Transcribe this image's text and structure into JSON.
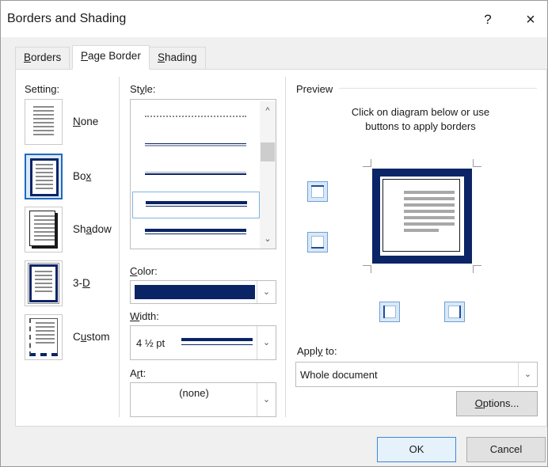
{
  "dialog": {
    "title": "Borders and Shading",
    "help_label": "?",
    "close_label": "×"
  },
  "tabs": [
    {
      "label": "Borders",
      "mnemonic": "B",
      "rest": "orders",
      "active": false
    },
    {
      "label": "Page Border",
      "mnemonic": "P",
      "rest": "age Border",
      "active": true
    },
    {
      "label": "Shading",
      "mnemonic": "S",
      "rest": "hading",
      "active": false
    }
  ],
  "setting": {
    "label": "Setting:",
    "items": [
      {
        "pre": "",
        "key": "N",
        "post": "one",
        "icon": "none-page-icon",
        "selected": false
      },
      {
        "pre": "Bo",
        "key": "x",
        "post": "",
        "icon": "box-page-icon",
        "selected": true
      },
      {
        "pre": "Sh",
        "key": "a",
        "post": "dow",
        "icon": "shadow-page-icon",
        "selected": false
      },
      {
        "pre": "3-",
        "key": "D",
        "post": "",
        "icon": "3d-page-icon",
        "selected": false
      },
      {
        "pre": "C",
        "key": "u",
        "post": "stom",
        "icon": "custom-page-icon",
        "selected": false
      }
    ]
  },
  "style": {
    "label_pre": "St",
    "label_key": "y",
    "label_post": "le:",
    "selected_index": 3
  },
  "color": {
    "label_key": "C",
    "label_post": "olor:",
    "value": "#0b2466"
  },
  "width": {
    "label_key": "W",
    "label_post": "idth:",
    "value": "4 ½ pt"
  },
  "art": {
    "label_pre": "A",
    "label_key": "r",
    "label_post": "t:",
    "value": "(none)"
  },
  "preview": {
    "label": "Preview",
    "hint_line1": "Click on diagram below or use",
    "hint_line2": "buttons to apply borders"
  },
  "apply_to": {
    "label_pre": "Appl",
    "label_key": "y",
    "label_post": " to:",
    "value": "Whole document"
  },
  "buttons": {
    "options_key": "O",
    "options_post": "ptions...",
    "ok": "OK",
    "cancel": "Cancel"
  },
  "colors": {
    "accent_border": "#0b2466",
    "selection": "#1e6ac1"
  }
}
